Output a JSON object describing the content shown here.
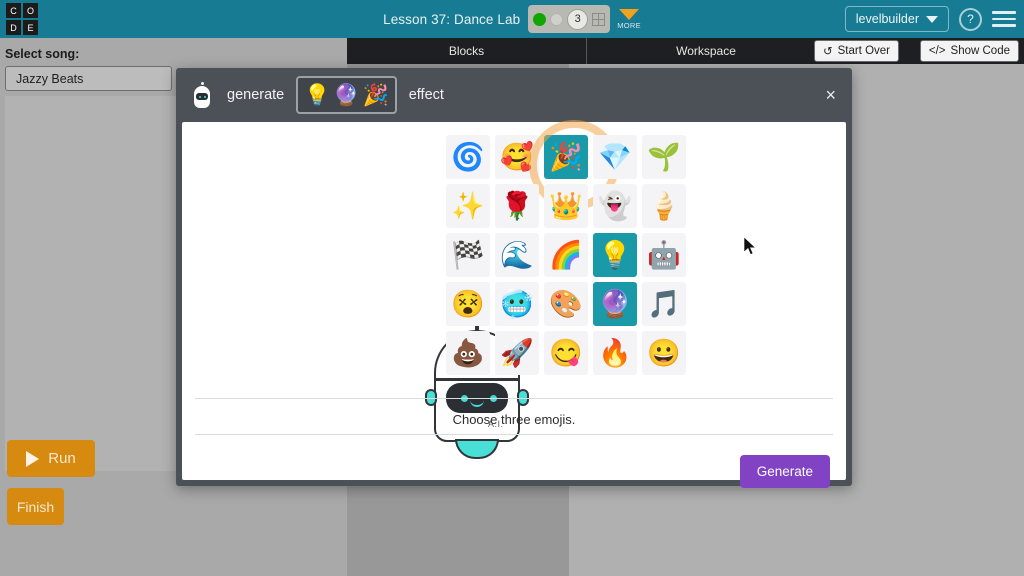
{
  "header": {
    "logo_letters": [
      "C",
      "O",
      "D",
      "E"
    ],
    "lesson_title": "Lesson 37: Dance Lab",
    "stage_number": "3",
    "more_label": "MORE",
    "user_name": "levelbuilder",
    "help_label": "?",
    "icons": {
      "grid": "grid-icon",
      "menu": "hamburger-icon"
    },
    "accent_color": "#177b93"
  },
  "left_panel": {
    "select_song_label": "Select song:",
    "selected_song": "Jazzy Beats",
    "run_label": "Run",
    "finish_label": "Finish",
    "button_color": "#d68a10"
  },
  "workspace": {
    "tabs": [
      {
        "label": "Blocks"
      },
      {
        "label": "Workspace"
      }
    ],
    "start_over_label": "Start Over",
    "show_code_label": "Show Code",
    "show_code_icon": "</>",
    "start_over_icon": "↺"
  },
  "modal": {
    "prefix_word": "generate",
    "suffix_word": "effect",
    "close_label": "×",
    "selected_emojis": [
      "💡",
      "🔮",
      "🎉"
    ],
    "robot_label": "A.I.",
    "prompt": "Choose three emojis.",
    "generate_label": "Generate",
    "generate_color": "#8142c4",
    "selected_cell_color": "#1a9aa8",
    "highlight_ring_color": "#f3a74a",
    "emoji_grid": [
      {
        "emoji": "🌀",
        "name": "cyclone",
        "selected": false,
        "highlighted": false
      },
      {
        "emoji": "🥰",
        "name": "smiling-face-hearts",
        "selected": false,
        "highlighted": false
      },
      {
        "emoji": "🎉",
        "name": "party-popper",
        "selected": true,
        "highlighted": true
      },
      {
        "emoji": "💎",
        "name": "gem",
        "selected": false,
        "highlighted": false
      },
      {
        "emoji": "🌱",
        "name": "seedling",
        "selected": false,
        "highlighted": false
      },
      {
        "emoji": "✨",
        "name": "sparkles",
        "selected": false,
        "highlighted": false
      },
      {
        "emoji": "🌹",
        "name": "rose",
        "selected": false,
        "highlighted": false
      },
      {
        "emoji": "👑",
        "name": "crown",
        "selected": false,
        "highlighted": false
      },
      {
        "emoji": "👻",
        "name": "ghost",
        "selected": false,
        "highlighted": false
      },
      {
        "emoji": "🍦",
        "name": "soft-ice-cream",
        "selected": false,
        "highlighted": false
      },
      {
        "emoji": "🏁",
        "name": "chequered-flag",
        "selected": false,
        "highlighted": false
      },
      {
        "emoji": "🌊",
        "name": "water-wave",
        "selected": false,
        "highlighted": false
      },
      {
        "emoji": "🌈",
        "name": "rainbow",
        "selected": false,
        "highlighted": false
      },
      {
        "emoji": "💡",
        "name": "light-bulb",
        "selected": true,
        "highlighted": false
      },
      {
        "emoji": "🤖",
        "name": "robot",
        "selected": false,
        "highlighted": false
      },
      {
        "emoji": "😵",
        "name": "face-spiral-eyes",
        "selected": false,
        "highlighted": false
      },
      {
        "emoji": "🥶",
        "name": "cold-face",
        "selected": false,
        "highlighted": false
      },
      {
        "emoji": "🎨",
        "name": "artist-palette",
        "selected": false,
        "highlighted": false
      },
      {
        "emoji": "🔮",
        "name": "crystal-ball",
        "selected": true,
        "highlighted": false
      },
      {
        "emoji": "🎵",
        "name": "musical-note",
        "selected": false,
        "highlighted": false
      },
      {
        "emoji": "💩",
        "name": "pile-of-poo",
        "selected": false,
        "highlighted": false
      },
      {
        "emoji": "🚀",
        "name": "rocket",
        "selected": false,
        "highlighted": false
      },
      {
        "emoji": "😋",
        "name": "face-savoring-food",
        "selected": false,
        "highlighted": false
      },
      {
        "emoji": "🔥",
        "name": "fire",
        "selected": false,
        "highlighted": false
      },
      {
        "emoji": "😀",
        "name": "grinning-face",
        "selected": false,
        "highlighted": false
      }
    ]
  }
}
